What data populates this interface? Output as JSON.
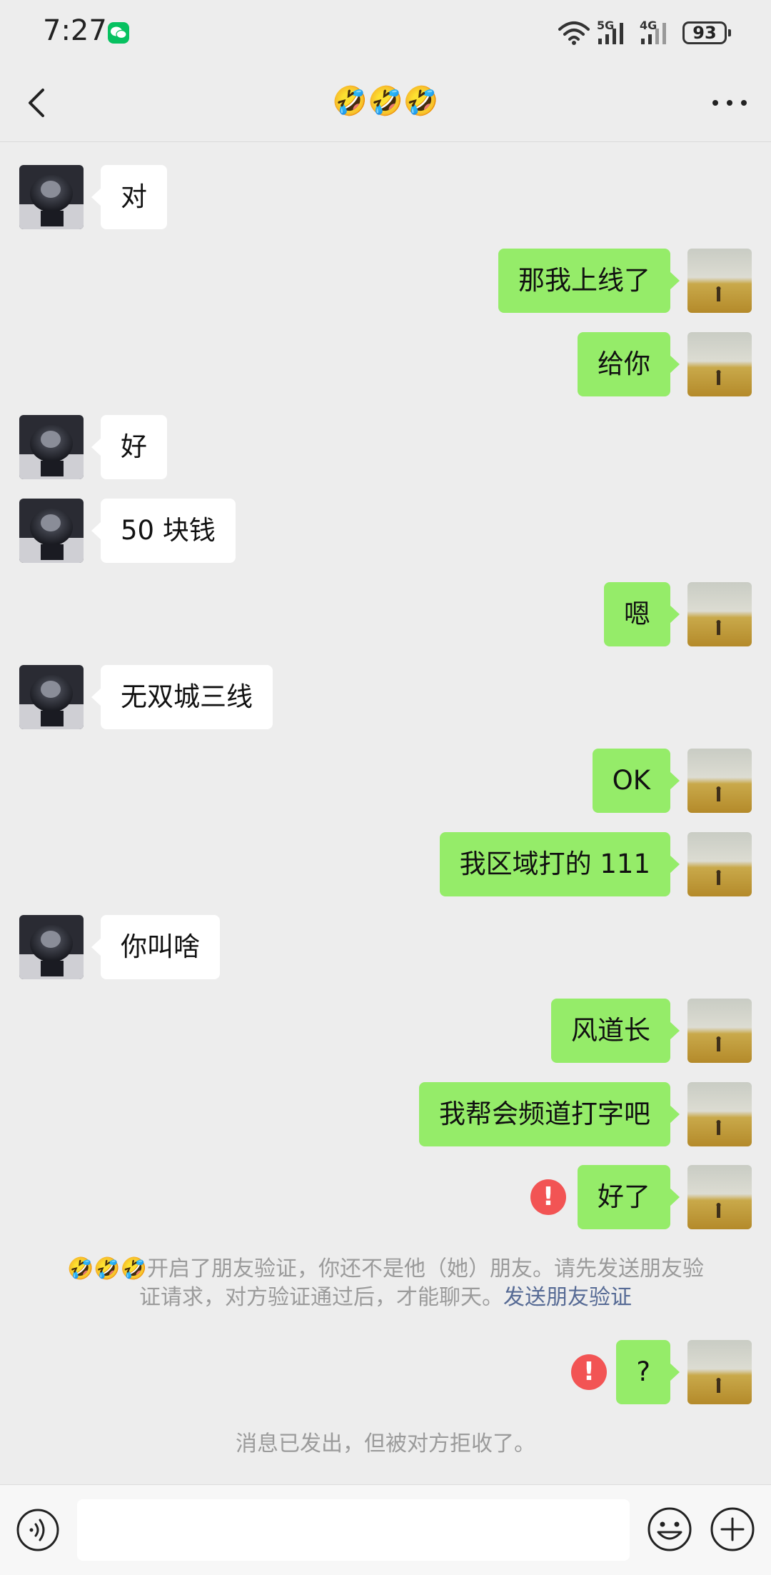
{
  "status_bar": {
    "time": "7:27",
    "battery": "93",
    "network_1": "5G",
    "network_2": "4G"
  },
  "header": {
    "title": "🤣🤣🤣"
  },
  "messages": [
    {
      "side": "in",
      "text": "对"
    },
    {
      "side": "out",
      "text": "那我上线了"
    },
    {
      "side": "out",
      "text": "给你"
    },
    {
      "side": "in",
      "text": "好"
    },
    {
      "side": "in",
      "text": "50 块钱"
    },
    {
      "side": "out",
      "text": "嗯"
    },
    {
      "side": "in",
      "text": "无双城三线"
    },
    {
      "side": "out",
      "text": "OK"
    },
    {
      "side": "out",
      "text": "我区域打的 111"
    },
    {
      "side": "in",
      "text": "你叫啥"
    },
    {
      "side": "out",
      "text": "风道长"
    },
    {
      "side": "out",
      "text": "我帮会频道打字吧"
    },
    {
      "side": "out",
      "text": "好了",
      "error": true
    },
    {
      "side": "out",
      "text": "?",
      "error": true
    }
  ],
  "error_mark": "!",
  "verification_notice": {
    "line1": "🤣🤣🤣开启了朋友验证，你还不是他（她）朋友。请先发送朋友验",
    "line2": "证请求，对方验证通过后，才能聊天。",
    "link": "发送朋友验证"
  },
  "rejected_notice": "消息已发出，但被对方拒收了。",
  "colors": {
    "outgoing_bubble": "#95ec69",
    "incoming_bubble": "#ffffff",
    "background": "#ededed",
    "error": "#f25454",
    "link": "#576b95"
  },
  "icons": {
    "back": "chevron-left-icon",
    "more": "more-dots-icon",
    "voice": "voice-icon",
    "emoji": "emoji-icon",
    "plus": "plus-icon"
  }
}
